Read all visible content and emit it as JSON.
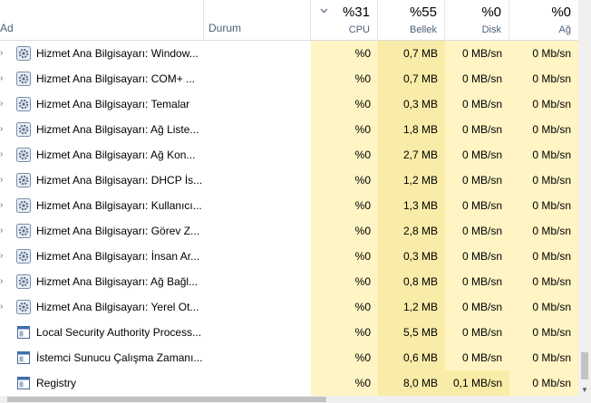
{
  "columns": {
    "name": "Ad",
    "status": "Durum",
    "cpu": {
      "pct": "%31",
      "label": "CPU"
    },
    "memory": {
      "pct": "%55",
      "label": "Bellek"
    },
    "disk": {
      "pct": "%0",
      "label": "Disk"
    },
    "network": {
      "pct": "%0",
      "label": "Ağ"
    }
  },
  "rows": [
    {
      "name": "Hizmet Ana Bilgisayarı: Window...",
      "icon": "gear-icon",
      "cpu": "%0",
      "mem": "0,7 MB",
      "disk": "0 MB/sn",
      "net": "0 Mb/sn"
    },
    {
      "name": "Hizmet Ana Bilgisayarı: COM+ ...",
      "icon": "gear-icon",
      "cpu": "%0",
      "mem": "0,7 MB",
      "disk": "0 MB/sn",
      "net": "0 Mb/sn"
    },
    {
      "name": "Hizmet Ana Bilgisayarı: Temalar",
      "icon": "gear-icon",
      "cpu": "%0",
      "mem": "0,3 MB",
      "disk": "0 MB/sn",
      "net": "0 Mb/sn"
    },
    {
      "name": "Hizmet Ana Bilgisayarı: Ağ Liste...",
      "icon": "gear-icon",
      "cpu": "%0",
      "mem": "1,8 MB",
      "disk": "0 MB/sn",
      "net": "0 Mb/sn"
    },
    {
      "name": "Hizmet Ana Bilgisayarı: Ağ Kon...",
      "icon": "gear-icon",
      "cpu": "%0",
      "mem": "2,7 MB",
      "disk": "0 MB/sn",
      "net": "0 Mb/sn"
    },
    {
      "name": "Hizmet Ana Bilgisayarı: DHCP İs...",
      "icon": "gear-icon",
      "cpu": "%0",
      "mem": "1,2 MB",
      "disk": "0 MB/sn",
      "net": "0 Mb/sn"
    },
    {
      "name": "Hizmet Ana Bilgisayarı: Kullanıcı...",
      "icon": "gear-icon",
      "cpu": "%0",
      "mem": "1,3 MB",
      "disk": "0 MB/sn",
      "net": "0 Mb/sn"
    },
    {
      "name": "Hizmet Ana Bilgisayarı: Görev Z...",
      "icon": "gear-icon",
      "cpu": "%0",
      "mem": "2,8 MB",
      "disk": "0 MB/sn",
      "net": "0 Mb/sn"
    },
    {
      "name": "Hizmet Ana Bilgisayarı: İnsan Ar...",
      "icon": "gear-icon",
      "cpu": "%0",
      "mem": "0,3 MB",
      "disk": "0 MB/sn",
      "net": "0 Mb/sn"
    },
    {
      "name": "Hizmet Ana Bilgisayarı: Ağ Bağl...",
      "icon": "gear-icon",
      "cpu": "%0",
      "mem": "0,8 MB",
      "disk": "0 MB/sn",
      "net": "0 Mb/sn"
    },
    {
      "name": "Hizmet Ana Bilgisayarı: Yerel Ot...",
      "icon": "gear-icon",
      "cpu": "%0",
      "mem": "1,2 MB",
      "disk": "0 MB/sn",
      "net": "0 Mb/sn"
    },
    {
      "name": "Local Security Authority Process...",
      "icon": "app-window-icon",
      "cpu": "%0",
      "mem": "5,5 MB",
      "disk": "0 MB/sn",
      "net": "0 Mb/sn"
    },
    {
      "name": "İstemci Sunucu Çalışma Zamanı...",
      "icon": "app-window-icon",
      "cpu": "%0",
      "mem": "0,6 MB",
      "disk": "0 MB/sn",
      "net": "0 Mb/sn"
    },
    {
      "name": "Registry",
      "icon": "app-window-icon",
      "cpu": "%0",
      "mem": "8,0 MB",
      "disk": "0,1 MB/sn",
      "net": "0 Mb/sn",
      "disk_active": true
    }
  ]
}
